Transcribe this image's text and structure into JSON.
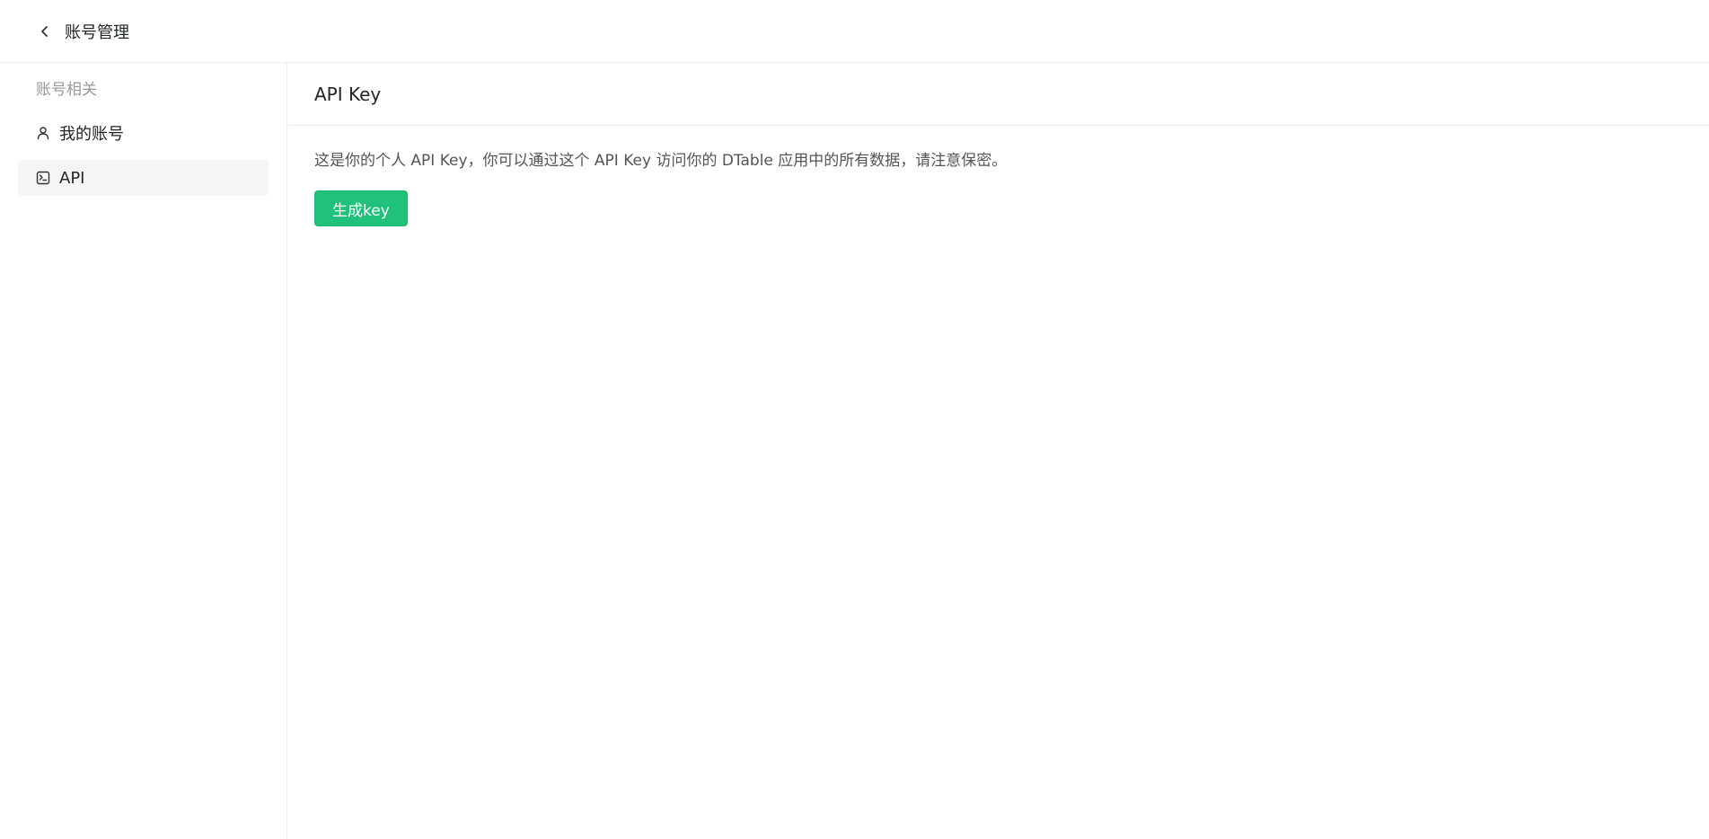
{
  "header": {
    "back_icon": "chevron-left-icon",
    "title": "账号管理"
  },
  "sidebar": {
    "heading": "账号相关",
    "items": [
      {
        "label": "我的账号",
        "icon": "user-icon",
        "active": false
      },
      {
        "label": "API",
        "icon": "terminal-icon",
        "active": true
      }
    ]
  },
  "main": {
    "title": "API Key",
    "description": "这是你的个人 API Key，你可以通过这个 API Key 访问你的 DTable 应用中的所有数据，请注意保密。",
    "generate_button": "生成key"
  },
  "colors": {
    "accent": "#20c17a",
    "active_bg": "#f5f5f5",
    "border": "#eeeeee",
    "muted_text": "#999999"
  }
}
